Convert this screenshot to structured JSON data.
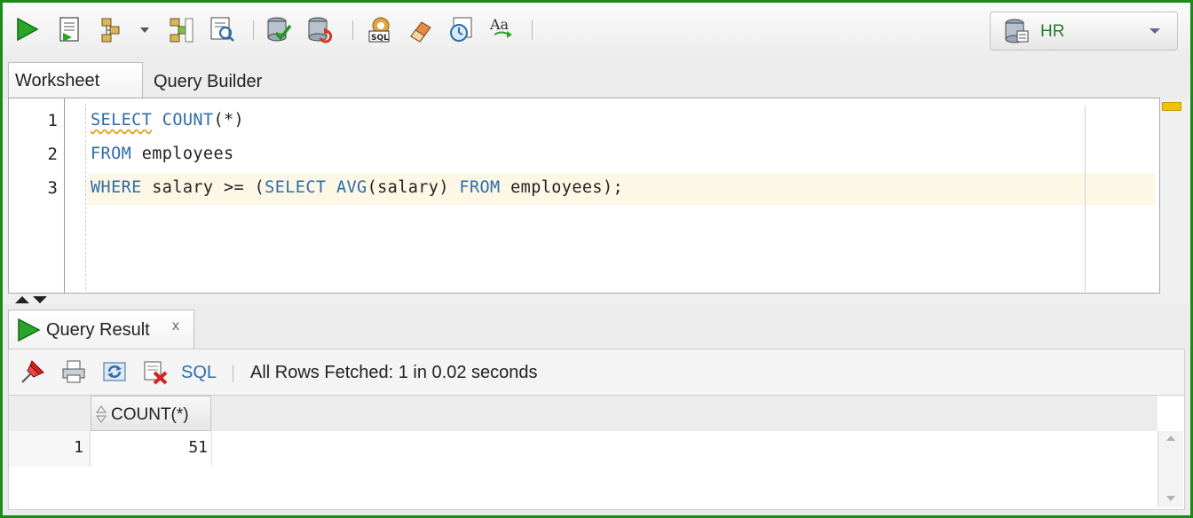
{
  "toolbar": {
    "buttons": [
      "run-statement",
      "run-script",
      "autotrace",
      "dropdown",
      "explain-plan",
      "sql-tuning-advisor",
      "commit",
      "rollback",
      "unshared-sql-worksheet",
      "clear",
      "sql-history",
      "to-upper-lower"
    ],
    "connection": {
      "label": "HR"
    }
  },
  "editor_tabs": [
    {
      "label": "Worksheet",
      "active": true
    },
    {
      "label": "Query Builder",
      "active": false
    }
  ],
  "editor": {
    "line_numbers": [
      "1",
      "2",
      "3"
    ],
    "lines": [
      [
        {
          "t": "SELECT",
          "kw": true,
          "squig": true
        },
        {
          "t": " "
        },
        {
          "t": "COUNT",
          "kw": true
        },
        {
          "t": "(*)"
        }
      ],
      [
        {
          "t": "FROM",
          "kw": true
        },
        {
          "t": " employees"
        }
      ],
      [
        {
          "t": "WHERE",
          "kw": true
        },
        {
          "t": " salary >= ("
        },
        {
          "t": "SELECT",
          "kw": true
        },
        {
          "t": " "
        },
        {
          "t": "AVG",
          "kw": true
        },
        {
          "t": "(salary) "
        },
        {
          "t": "FROM",
          "kw": true
        },
        {
          "t": " employees);"
        }
      ]
    ],
    "keyword_color": "#2f6ca8",
    "current_line_highlight": "#fdf8e5"
  },
  "results": {
    "tab_label": "Query Result",
    "close_glyph": "x",
    "sql_link": "SQL",
    "status": "All Rows Fetched: 1 in 0.02 seconds",
    "columns": [
      "COUNT(*)"
    ],
    "rows": [
      {
        "num": "1",
        "values": [
          "51"
        ]
      }
    ]
  },
  "colors": {
    "frame": "#1a8a1a",
    "accent_green": "#2b7a2b"
  }
}
